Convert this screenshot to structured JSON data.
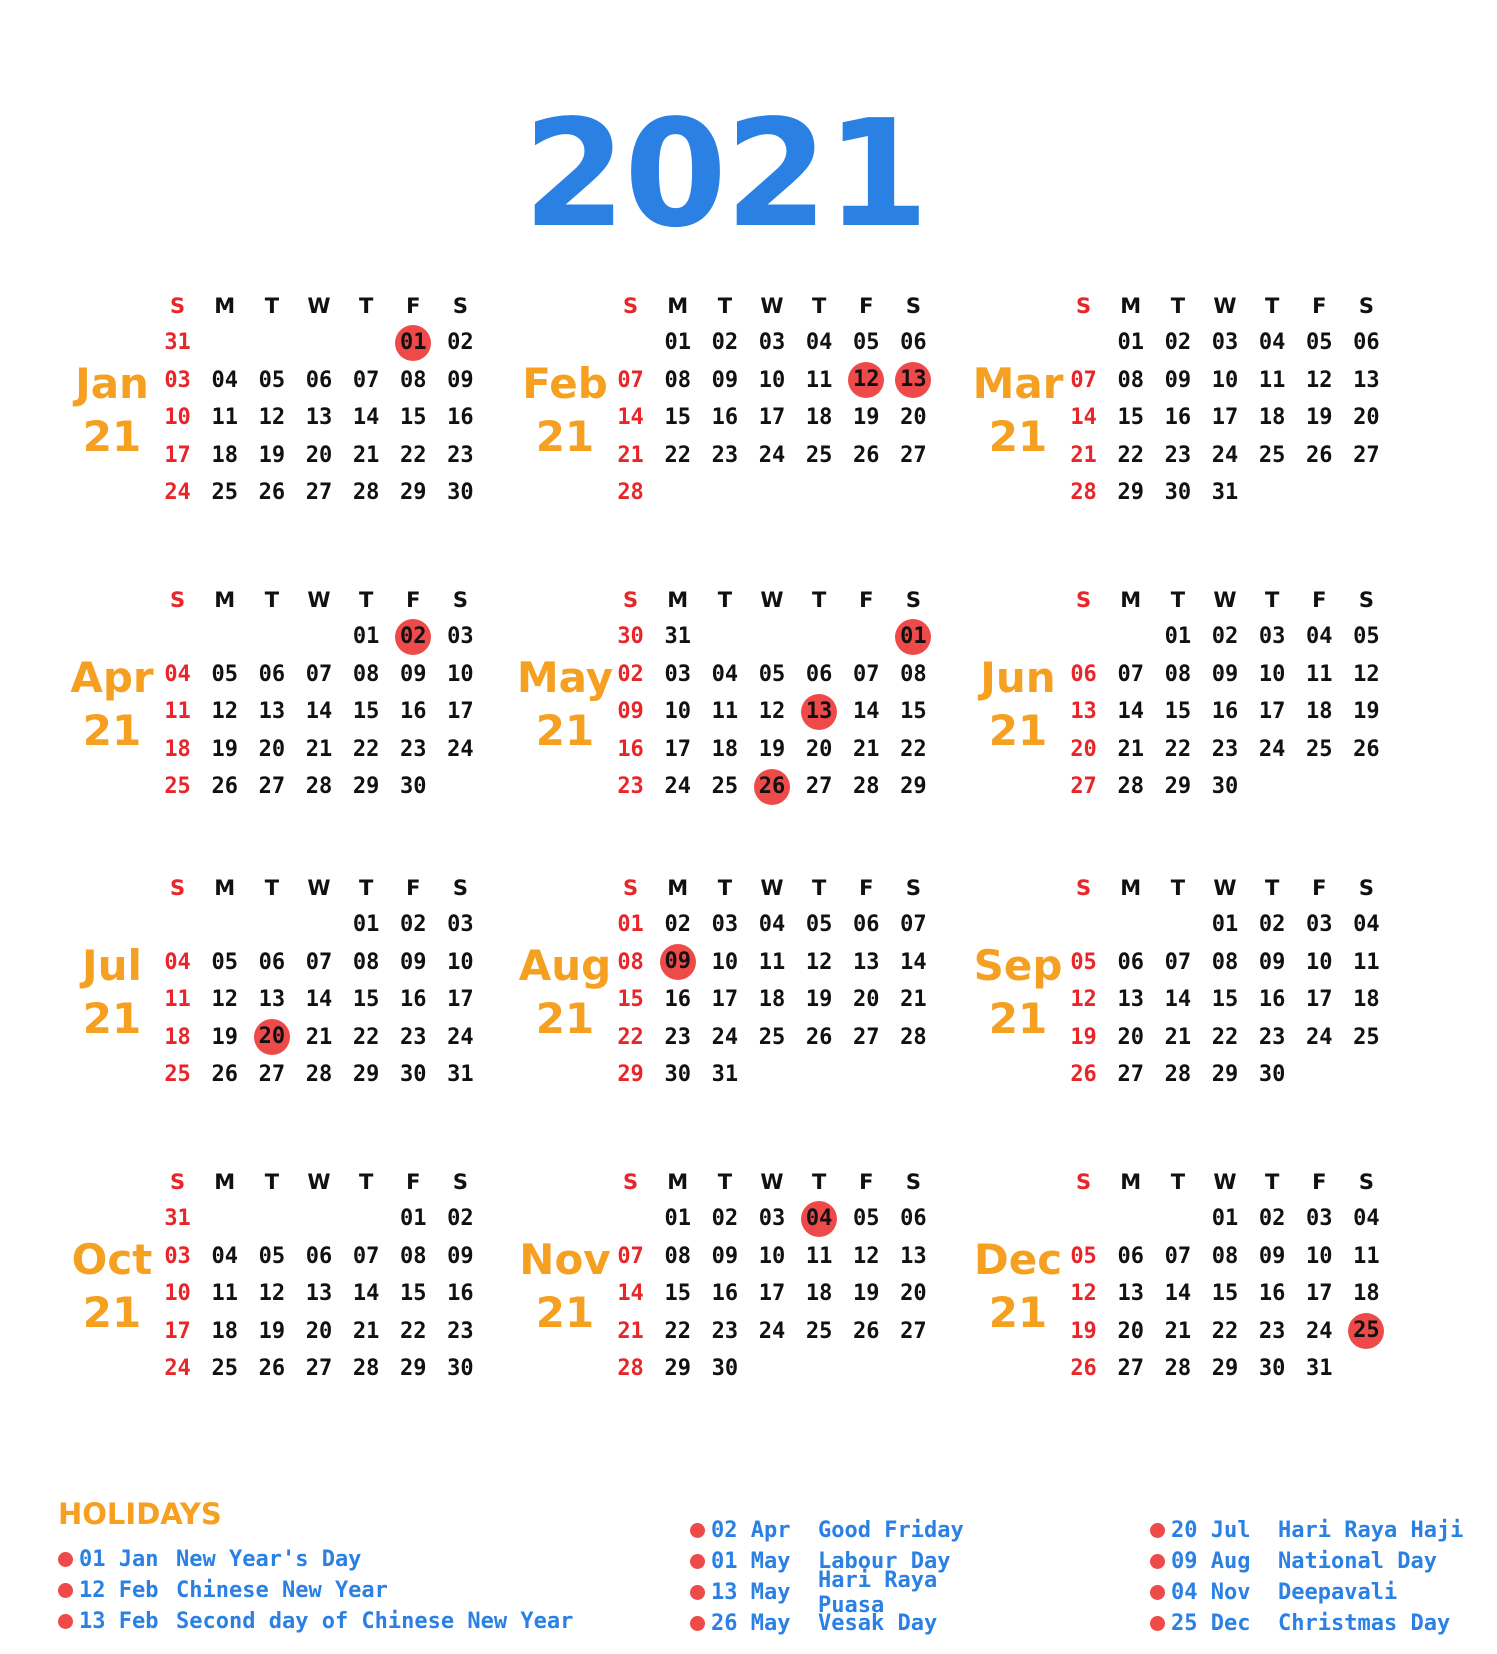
{
  "year": "2021",
  "weekdays": [
    "S",
    "M",
    "T",
    "W",
    "T",
    "F",
    "S"
  ],
  "months": [
    {
      "name": "Jan",
      "year": "21",
      "weeks": [
        [
          "31",
          "",
          "",
          "",
          "",
          "01",
          "02"
        ],
        [
          "03",
          "04",
          "05",
          "06",
          "07",
          "08",
          "09"
        ],
        [
          "10",
          "11",
          "12",
          "13",
          "14",
          "15",
          "16"
        ],
        [
          "17",
          "18",
          "19",
          "20",
          "21",
          "22",
          "23"
        ],
        [
          "24",
          "25",
          "26",
          "27",
          "28",
          "29",
          "30"
        ]
      ],
      "holidays": [
        "01"
      ]
    },
    {
      "name": "Feb",
      "year": "21",
      "weeks": [
        [
          "",
          "01",
          "02",
          "03",
          "04",
          "05",
          "06"
        ],
        [
          "07",
          "08",
          "09",
          "10",
          "11",
          "12",
          "13"
        ],
        [
          "14",
          "15",
          "16",
          "17",
          "18",
          "19",
          "20"
        ],
        [
          "21",
          "22",
          "23",
          "24",
          "25",
          "26",
          "27"
        ],
        [
          "28",
          "",
          "",
          "",
          "",
          "",
          ""
        ]
      ],
      "holidays": [
        "12",
        "13"
      ]
    },
    {
      "name": "Mar",
      "year": "21",
      "weeks": [
        [
          "",
          "01",
          "02",
          "03",
          "04",
          "05",
          "06"
        ],
        [
          "07",
          "08",
          "09",
          "10",
          "11",
          "12",
          "13"
        ],
        [
          "14",
          "15",
          "16",
          "17",
          "18",
          "19",
          "20"
        ],
        [
          "21",
          "22",
          "23",
          "24",
          "25",
          "26",
          "27"
        ],
        [
          "28",
          "29",
          "30",
          "31",
          "",
          "",
          ""
        ]
      ],
      "holidays": []
    },
    {
      "name": "Apr",
      "year": "21",
      "weeks": [
        [
          "",
          "",
          "",
          "",
          "01",
          "02",
          "03"
        ],
        [
          "04",
          "05",
          "06",
          "07",
          "08",
          "09",
          "10"
        ],
        [
          "11",
          "12",
          "13",
          "14",
          "15",
          "16",
          "17"
        ],
        [
          "18",
          "19",
          "20",
          "21",
          "22",
          "23",
          "24"
        ],
        [
          "25",
          "26",
          "27",
          "28",
          "29",
          "30",
          ""
        ]
      ],
      "holidays": [
        "02"
      ]
    },
    {
      "name": "May",
      "year": "21",
      "weeks": [
        [
          "30",
          "31",
          "",
          "",
          "",
          "",
          "01"
        ],
        [
          "02",
          "03",
          "04",
          "05",
          "06",
          "07",
          "08"
        ],
        [
          "09",
          "10",
          "11",
          "12",
          "13",
          "14",
          "15"
        ],
        [
          "16",
          "17",
          "18",
          "19",
          "20",
          "21",
          "22"
        ],
        [
          "23",
          "24",
          "25",
          "26",
          "27",
          "28",
          "29"
        ]
      ],
      "holidays": [
        "01",
        "13",
        "26"
      ]
    },
    {
      "name": "Jun",
      "year": "21",
      "weeks": [
        [
          "",
          "",
          "01",
          "02",
          "03",
          "04",
          "05"
        ],
        [
          "06",
          "07",
          "08",
          "09",
          "10",
          "11",
          "12"
        ],
        [
          "13",
          "14",
          "15",
          "16",
          "17",
          "18",
          "19"
        ],
        [
          "20",
          "21",
          "22",
          "23",
          "24",
          "25",
          "26"
        ],
        [
          "27",
          "28",
          "29",
          "30",
          "",
          "",
          ""
        ]
      ],
      "holidays": []
    },
    {
      "name": "Jul",
      "year": "21",
      "weeks": [
        [
          "",
          "",
          "",
          "",
          "01",
          "02",
          "03"
        ],
        [
          "04",
          "05",
          "06",
          "07",
          "08",
          "09",
          "10"
        ],
        [
          "11",
          "12",
          "13",
          "14",
          "15",
          "16",
          "17"
        ],
        [
          "18",
          "19",
          "20",
          "21",
          "22",
          "23",
          "24"
        ],
        [
          "25",
          "26",
          "27",
          "28",
          "29",
          "30",
          "31"
        ]
      ],
      "holidays": [
        "20"
      ]
    },
    {
      "name": "Aug",
      "year": "21",
      "weeks": [
        [
          "01",
          "02",
          "03",
          "04",
          "05",
          "06",
          "07"
        ],
        [
          "08",
          "09",
          "10",
          "11",
          "12",
          "13",
          "14"
        ],
        [
          "15",
          "16",
          "17",
          "18",
          "19",
          "20",
          "21"
        ],
        [
          "22",
          "23",
          "24",
          "25",
          "26",
          "27",
          "28"
        ],
        [
          "29",
          "30",
          "31",
          "",
          "",
          "",
          ""
        ]
      ],
      "holidays": [
        "09"
      ]
    },
    {
      "name": "Sep",
      "year": "21",
      "weeks": [
        [
          "",
          "",
          "",
          "01",
          "02",
          "03",
          "04"
        ],
        [
          "05",
          "06",
          "07",
          "08",
          "09",
          "10",
          "11"
        ],
        [
          "12",
          "13",
          "14",
          "15",
          "16",
          "17",
          "18"
        ],
        [
          "19",
          "20",
          "21",
          "22",
          "23",
          "24",
          "25"
        ],
        [
          "26",
          "27",
          "28",
          "29",
          "30",
          "",
          ""
        ]
      ],
      "holidays": []
    },
    {
      "name": "Oct",
      "year": "21",
      "weeks": [
        [
          "31",
          "",
          "",
          "",
          "",
          "01",
          "02"
        ],
        [
          "03",
          "04",
          "05",
          "06",
          "07",
          "08",
          "09"
        ],
        [
          "10",
          "11",
          "12",
          "13",
          "14",
          "15",
          "16"
        ],
        [
          "17",
          "18",
          "19",
          "20",
          "21",
          "22",
          "23"
        ],
        [
          "24",
          "25",
          "26",
          "27",
          "28",
          "29",
          "30"
        ]
      ],
      "holidays": []
    },
    {
      "name": "Nov",
      "year": "21",
      "weeks": [
        [
          "",
          "01",
          "02",
          "03",
          "04",
          "05",
          "06"
        ],
        [
          "07",
          "08",
          "09",
          "10",
          "11",
          "12",
          "13"
        ],
        [
          "14",
          "15",
          "16",
          "17",
          "18",
          "19",
          "20"
        ],
        [
          "21",
          "22",
          "23",
          "24",
          "25",
          "26",
          "27"
        ],
        [
          "28",
          "29",
          "30",
          "",
          "",
          "",
          ""
        ]
      ],
      "holidays": [
        "04"
      ]
    },
    {
      "name": "Dec",
      "year": "21",
      "weeks": [
        [
          "",
          "",
          "",
          "01",
          "02",
          "03",
          "04"
        ],
        [
          "05",
          "06",
          "07",
          "08",
          "09",
          "10",
          "11"
        ],
        [
          "12",
          "13",
          "14",
          "15",
          "16",
          "17",
          "18"
        ],
        [
          "19",
          "20",
          "21",
          "22",
          "23",
          "24",
          "25"
        ],
        [
          "26",
          "27",
          "28",
          "29",
          "30",
          "31",
          ""
        ]
      ],
      "holidays": [
        "25"
      ]
    }
  ],
  "holidays_title": "HOLIDAYS",
  "holiday_columns": [
    [
      {
        "date": "01 Jan",
        "name": "New Year's Day"
      },
      {
        "date": "12 Feb",
        "name": "Chinese New Year"
      },
      {
        "date": "13 Feb",
        "name": "Second day of Chinese New Year"
      }
    ],
    [
      {
        "date": "02 Apr",
        "name": "Good Friday"
      },
      {
        "date": "01 May",
        "name": "Labour Day"
      },
      {
        "date": "13 May",
        "name": "Hari Raya Puasa"
      },
      {
        "date": "26 May",
        "name": "Vesak Day"
      }
    ],
    [
      {
        "date": "20 Jul",
        "name": "Hari Raya Haji"
      },
      {
        "date": "09 Aug",
        "name": "National Day"
      },
      {
        "date": "04 Nov",
        "name": "Deepavali"
      },
      {
        "date": "25 Dec",
        "name": "Christmas Day"
      }
    ]
  ],
  "colors": {
    "year": "#2b80e4",
    "month_label": "#f5a020",
    "sunday": "#e8262a",
    "holiday_marker": "#ef4a4a",
    "holiday_text": "#2b80e4"
  }
}
